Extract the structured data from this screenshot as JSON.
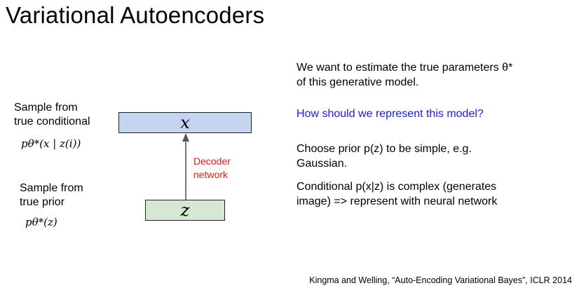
{
  "title": "Variational Autoencoders",
  "left": {
    "conditional_label_line1": "Sample from",
    "conditional_label_line2": "true conditional",
    "conditional_formula": "pθ*(x | z(i))",
    "prior_label_line1": "Sample from",
    "prior_label_line2": "true prior",
    "prior_formula": "pθ*(z)"
  },
  "diagram": {
    "x_box": "x",
    "z_box": "z",
    "arrow_label_line1": "Decoder",
    "arrow_label_line2": "network",
    "x_box_color": "#c5d5f1",
    "z_box_color": "#d5e8d4",
    "arrow_label_color": "#e31a1a"
  },
  "right": {
    "para1_line1": "We want to estimate the true parameters θ*",
    "para1_line2": "of this generative model.",
    "question": "How should we represent this model?",
    "question_color": "#1a1adb",
    "para2_line1": "Choose prior p(z) to be simple, e.g.",
    "para2_line2": "Gaussian.",
    "para3_line1": "Conditional p(x|z) is complex (generates",
    "para3_line2": "image) => represent with neural network"
  },
  "citation": "Kingma and Welling, “Auto-Encoding Variational Bayes”, ICLR 2014"
}
